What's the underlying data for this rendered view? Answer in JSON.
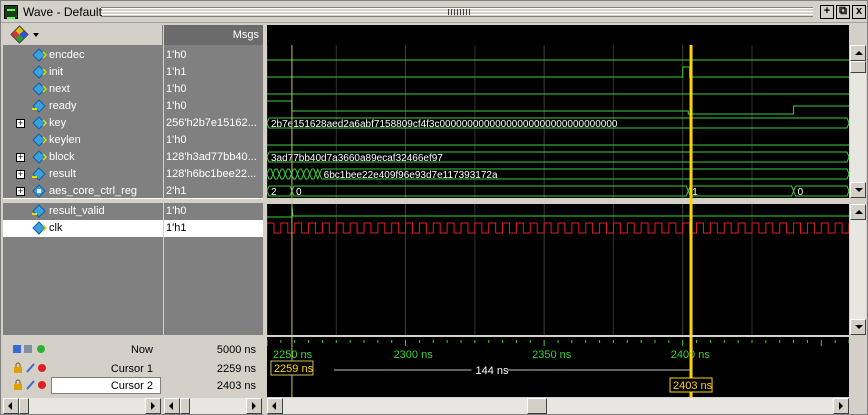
{
  "window": {
    "title": "Wave - Default"
  },
  "title_buttons": {
    "add": "+",
    "float": "⧉",
    "close": "x"
  },
  "header": {
    "msgs_label": "Msgs"
  },
  "signals": [
    {
      "name": "encdec",
      "value": "1'h0",
      "expandable": false,
      "icon": "input-port-icon"
    },
    {
      "name": "init",
      "value": "1'h1",
      "expandable": false,
      "icon": "input-port-icon"
    },
    {
      "name": "next",
      "value": "1'h0",
      "expandable": false,
      "icon": "input-port-icon"
    },
    {
      "name": "ready",
      "value": "1'h0",
      "expandable": false,
      "icon": "output-port-icon"
    },
    {
      "name": "key",
      "value": "256'h2b7e15162...",
      "expandable": true,
      "icon": "input-port-icon"
    },
    {
      "name": "keylen",
      "value": "1'h0",
      "expandable": false,
      "icon": "input-port-icon"
    },
    {
      "name": "block",
      "value": "128'h3ad77bb40...",
      "expandable": true,
      "icon": "input-port-icon"
    },
    {
      "name": "result",
      "value": "128'h6bc1bee22...",
      "expandable": true,
      "icon": "output-port-icon"
    },
    {
      "name": "aes_core_ctrl_reg",
      "value": "2'h1",
      "expandable": true,
      "icon": "register-icon"
    }
  ],
  "signals2": [
    {
      "name": "result_valid",
      "value": "1'h0",
      "icon": "output-port-icon"
    },
    {
      "name": "clk",
      "value": "1'h1",
      "icon": "input-port-icon",
      "selected": true
    }
  ],
  "bus_labels": {
    "key": "2b7e151628aed2a6abf7158809cf4f3c00000000000000000000000000000000",
    "block": "3ad77bb40d7a3660a89ecaf32466ef97",
    "result": "6bc1bee22e409f96e93d7e117393172a",
    "ctrl_a": "2",
    "ctrl_b": "0",
    "ctrl_c": "1",
    "ctrl_d": "0"
  },
  "cursors": {
    "now_label": "Now",
    "now_value": "5000 ns",
    "rows": [
      {
        "label": "Cursor 1",
        "value": "2259 ns",
        "tag": "2259 ns"
      },
      {
        "label": "Cursor 2",
        "value": "2403 ns",
        "tag": "2403 ns"
      }
    ],
    "delta": "144 ns"
  },
  "timeline": {
    "ticks": [
      "2250 ns",
      "2300 ns",
      "2350 ns",
      "2400 ns"
    ],
    "t_start": 2250,
    "t_end": 2460
  },
  "colors": {
    "wave": "#39d139",
    "clk": "#e02020",
    "cursor_active": "#ffd400",
    "cursor_inactive": "#c8c060",
    "bus_text": "#ffffff"
  }
}
